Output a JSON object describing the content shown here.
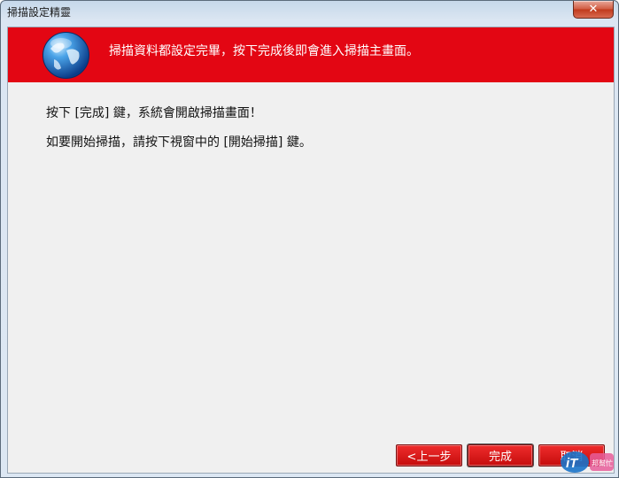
{
  "window": {
    "title": "掃描設定精靈",
    "close_icon": "close-icon"
  },
  "banner": {
    "text": "掃描資料都設定完畢，按下完成後即會進入掃描主畫面。",
    "icon": "globe-icon",
    "color": "#e30613"
  },
  "body": {
    "line1": "按下 [完成] 鍵，系統會開啟掃描畫面！",
    "line2": "如要開始掃描，請按下視窗中的 [開始掃描] 鍵。"
  },
  "buttons": {
    "back": "<上一步",
    "finish": "完成",
    "cancel": "取消"
  },
  "watermark": {
    "main": "iT",
    "sub": "邦幫忙"
  }
}
